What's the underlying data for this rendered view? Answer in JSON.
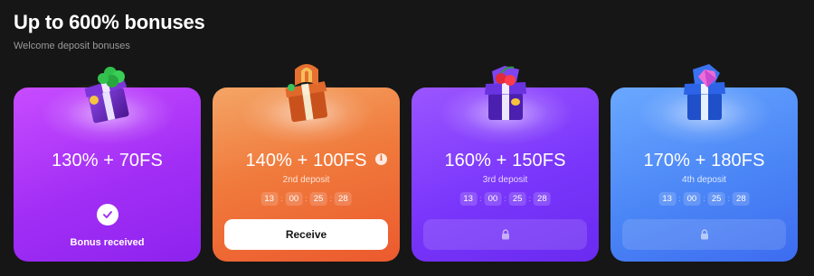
{
  "header": {
    "title": "Up to 600% bonuses",
    "subtitle": "Welcome deposit bonuses"
  },
  "cards": [
    {
      "amount": "130% + 70FS",
      "status_text": "Bonus received",
      "gift_icon": "gift-box-clover-icon",
      "color": "#a22ef5"
    },
    {
      "amount": "140% + 100FS",
      "deposit_label": "2nd deposit",
      "timer": [
        "13",
        "00",
        "25",
        "28"
      ],
      "button_label": "Receive",
      "gift_icon": "gift-box-horseshoe-icon",
      "color": "#f07a3c"
    },
    {
      "amount": "160% + 150FS",
      "deposit_label": "3rd deposit",
      "timer": [
        "13",
        "00",
        "25",
        "28"
      ],
      "gift_icon": "gift-box-cherry-icon",
      "color": "#7a36fb"
    },
    {
      "amount": "170% + 180FS",
      "deposit_label": "4th deposit",
      "timer": [
        "13",
        "00",
        "25",
        "28"
      ],
      "gift_icon": "gift-box-diamond-icon",
      "color": "#4b86f6"
    }
  ]
}
